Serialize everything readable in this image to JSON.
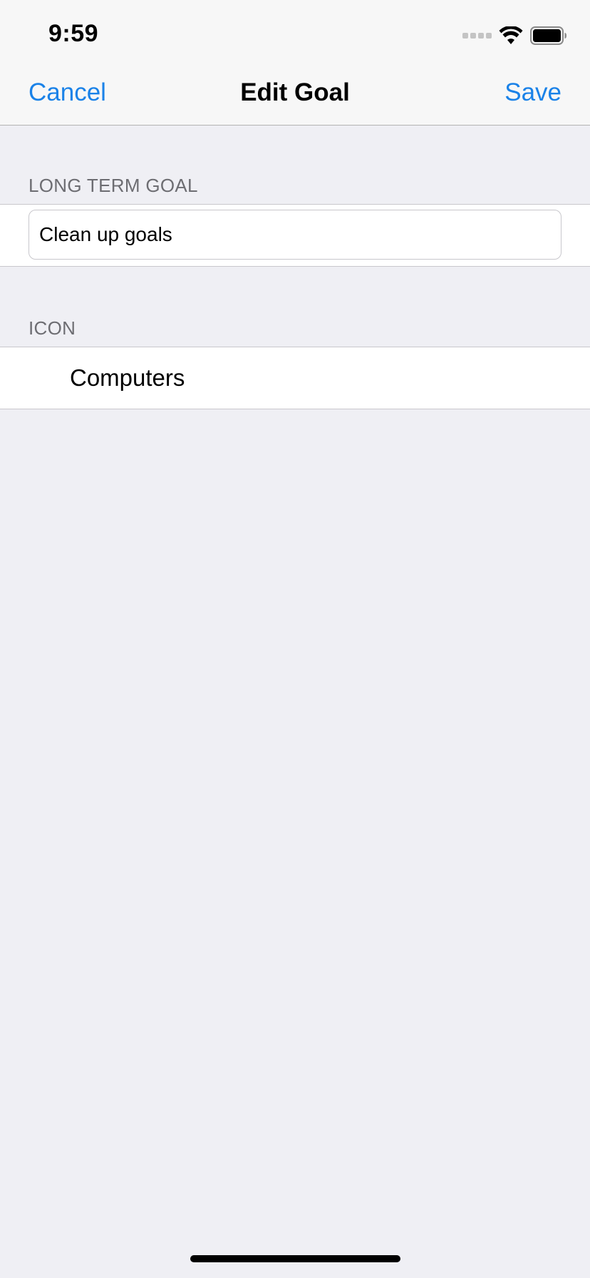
{
  "status_bar": {
    "time": "9:59",
    "signal_icon": "signal-dots-icon",
    "wifi_icon": "wifi-icon",
    "battery_icon": "battery-icon"
  },
  "nav": {
    "cancel_label": "Cancel",
    "title": "Edit Goal",
    "save_label": "Save",
    "accent_color": "#1a82e8"
  },
  "long_term_goal": {
    "header": "LONG TERM GOAL",
    "value": "Clean up goals"
  },
  "icon_section": {
    "header": "ICON",
    "selected_label": "Computers"
  }
}
